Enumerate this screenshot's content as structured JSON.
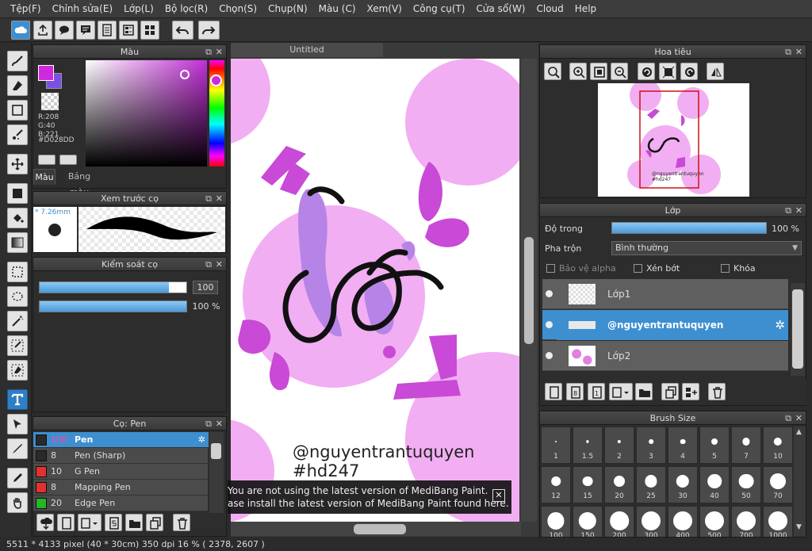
{
  "menu": [
    "Tệp(F)",
    "Chỉnh sửa(E)",
    "Lớp(L)",
    "Bộ lọc(R)",
    "Chọn(S)",
    "Chụp(N)",
    "Màu (C)",
    "Xem(V)",
    "Công cụ(T)",
    "Cửa sổ(W)",
    "Cloud",
    "Help"
  ],
  "toolbar": {
    "icons": [
      "cloud-icon",
      "upload-icon",
      "comment-icon",
      "chat-icon",
      "page-icon",
      "pages-icon",
      "grid-page-icon",
      "undo-icon",
      "redo-icon"
    ]
  },
  "color_panel": {
    "title": "Màu",
    "primary_color": "#D028DD",
    "r_label": "R:208",
    "g_label": "G:40",
    "b_label": "B:221",
    "hex_label": "#D028DD",
    "tab_color": "Màu",
    "tab_palette": "Bảng màu"
  },
  "brush_preview": {
    "title": "Xem trước cọ",
    "size": "* 7.26mm"
  },
  "brush_control": {
    "title": "Kiểm soát cọ",
    "size_value": "100",
    "opacity_value": "100 %",
    "size_fraction": 0.88,
    "opacity_fraction": 1.0
  },
  "brush_list": {
    "title": "Cọ: Pen",
    "items": [
      {
        "size": "100",
        "name": "Pen",
        "color": "#2a2a2a"
      },
      {
        "size": "8",
        "name": "Pen (Sharp)",
        "color": "#2a2a2a"
      },
      {
        "size": "10",
        "name": "G Pen",
        "color": "#e53030"
      },
      {
        "size": "8",
        "name": "Mapping Pen",
        "color": "#e53030"
      },
      {
        "size": "20",
        "name": "Edge Pen",
        "color": "#25b525"
      }
    ]
  },
  "document": {
    "tab_title": "Untitled",
    "watermark_line1": "@nguyentrantuquyen",
    "watermark_line2": "#hd247",
    "notice_line1": "You are not using the latest version of MediBang Paint.",
    "notice_line2": "ase install the latest version of MediBang Paint found here.",
    "notice_close": "✕"
  },
  "navigator": {
    "title": "Hoa tiêu"
  },
  "layer_panel": {
    "title": "Lớp",
    "opacity_label": "Độ trong",
    "opacity_value": "100 %",
    "opacity_fraction": 1.0,
    "blend_label": "Pha trộn",
    "blend_value": "Bình thường",
    "protect_alpha": "Bảo vệ alpha",
    "clipping": "Xén bớt",
    "lock": "Khóa",
    "layers": [
      {
        "name": "Lớp1"
      },
      {
        "name": "@nguyentrantuquyen"
      },
      {
        "name": "Lớp2"
      }
    ]
  },
  "brush_size": {
    "title": "Brush Size",
    "sizes": [
      "1",
      "1.5",
      "2",
      "3",
      "4",
      "5",
      "7",
      "10",
      "12",
      "15",
      "20",
      "25",
      "30",
      "40",
      "50",
      "70",
      "100",
      "150",
      "200",
      "300",
      "400",
      "500",
      "700",
      "1000"
    ]
  },
  "status": {
    "text": "5511 * 4133 pixel  (40 * 30cm)  350 dpi  16 %  ( 2378, 2607 )"
  }
}
